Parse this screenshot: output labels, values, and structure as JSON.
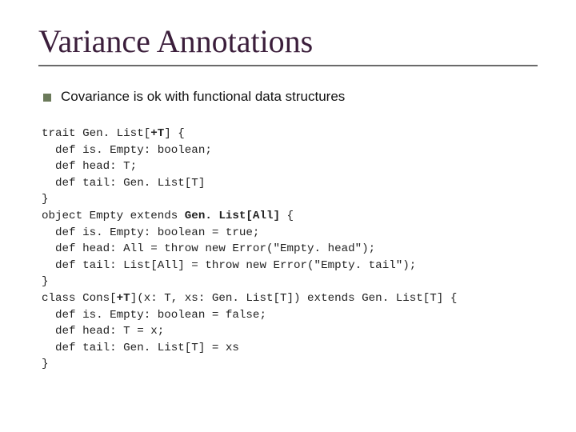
{
  "title": "Variance Annotations",
  "bullet": "Covariance is ok with functional data structures",
  "code": {
    "l1a": "trait Gen. List[",
    "l1b": "+T",
    "l1c": "] {",
    "l2": "  def is. Empty: boolean;",
    "l3": "  def head: T;",
    "l4": "  def tail: Gen. List[T]",
    "l5": "}",
    "l6a": "object Empty extends ",
    "l6b": "Gen. List[All]",
    "l6c": " {",
    "l7": "  def is. Empty: boolean = true;",
    "l8": "  def head: All = throw new Error(\"Empty. head\");",
    "l9": "  def tail: List[All] = throw new Error(\"Empty. tail\");",
    "l10": "}",
    "l11a": "class Cons[",
    "l11b": "+T",
    "l11c": "](x: T, xs: Gen. List[T]) extends Gen. List[T] {",
    "l12": "  def is. Empty: boolean = false;",
    "l13": "  def head: T = x;",
    "l14": "  def tail: Gen. List[T] = xs",
    "l15": "}"
  }
}
